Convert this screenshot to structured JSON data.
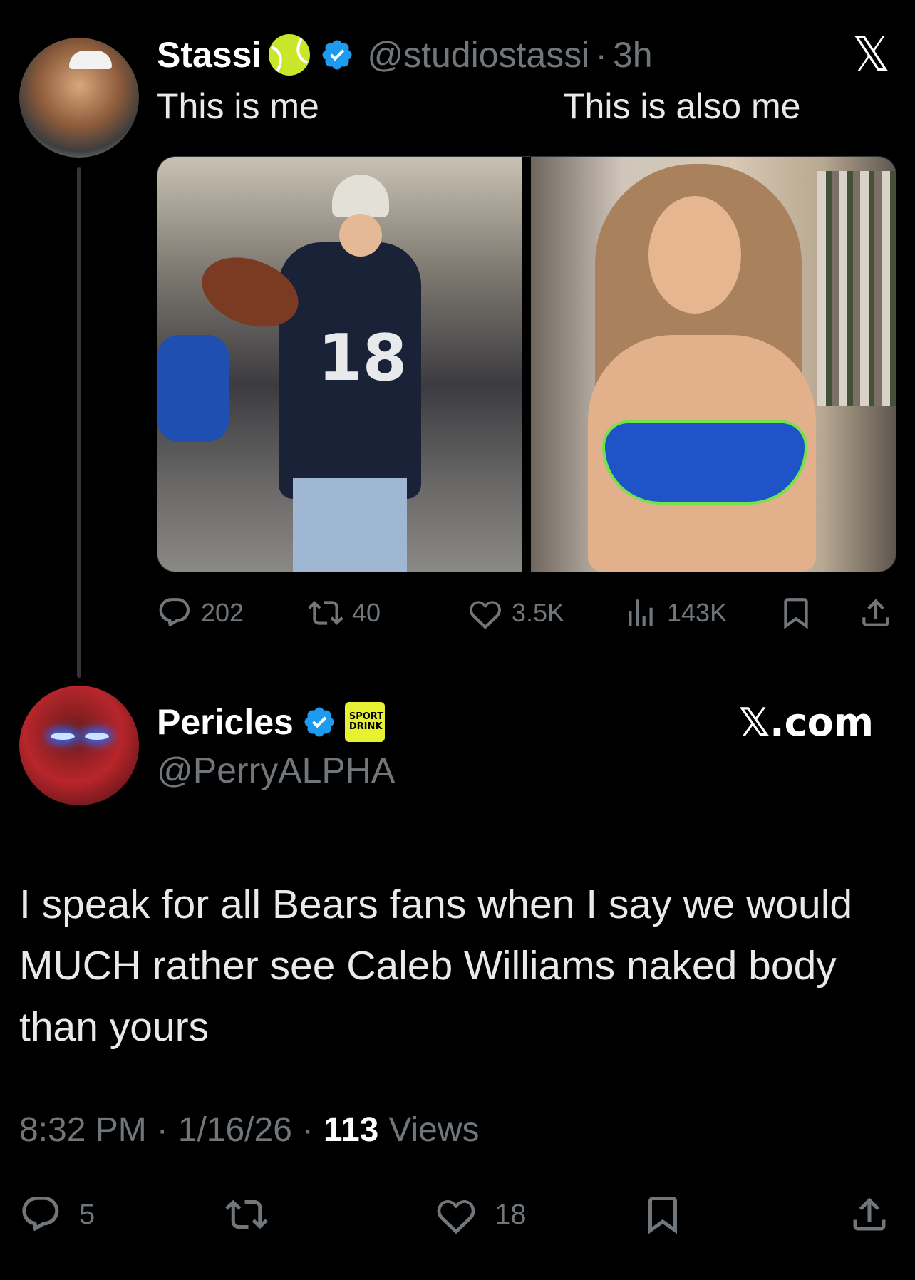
{
  "original_tweet": {
    "author_name": "Stassi",
    "handle": "@studiostassi",
    "separator": "·",
    "time": "3h",
    "caption_left": "This is me",
    "caption_right": "This is also me",
    "images": [
      {
        "alt": "Woman in Bears jersey holding a football at a tailgate"
      },
      {
        "alt": "Selfie of woman in a blue bikini in a closet"
      }
    ],
    "metrics": {
      "replies": "202",
      "reposts": "40",
      "likes": "3.5K",
      "views": "143K"
    }
  },
  "reply_tweet": {
    "author_name": "Pericles",
    "handle": "@PerryALPHA",
    "affiliate_badge_text": "SPORT DRINK",
    "body": "I speak for all Bears fans when I say we would MUCH rather see Caleb Williams naked body than yours",
    "timestamp_time": "8:32 PM",
    "timestamp_sep": "·",
    "timestamp_date": "1/16/26",
    "views_count": "113",
    "views_label": "Views",
    "metrics": {
      "replies": "5",
      "likes": "18"
    }
  },
  "branding": {
    "top_logo": "𝕏",
    "site_label": "𝕏.com"
  },
  "colors": {
    "background": "#000000",
    "text": "#e7e9ea",
    "muted": "#71767b",
    "verified_blue": "#1d9bf0",
    "affiliate_yellow": "#e6f231"
  }
}
